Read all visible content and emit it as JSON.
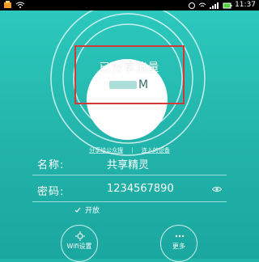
{
  "status_bar": {
    "time": "11:37"
  },
  "share_display": {
    "title": "已分享流量",
    "unit": "M"
  },
  "links": {
    "left": "分享给公众搜",
    "right": "连入的设备"
  },
  "form": {
    "name_label": "名称:",
    "name_value": "共享精灵",
    "password_label": "密码:",
    "password_value": "1234567890",
    "open_label": "开放"
  },
  "buttons": {
    "wifi_settings": "Wifi设置",
    "more": "更多"
  },
  "colors": {
    "background": "#22b3aa",
    "highlight": "#d23a3a"
  },
  "icons": [
    "orange-app-icon",
    "wifi-icon",
    "battery-icon",
    "gear-icon",
    "dots-icon",
    "eye-icon",
    "check-icon"
  ]
}
